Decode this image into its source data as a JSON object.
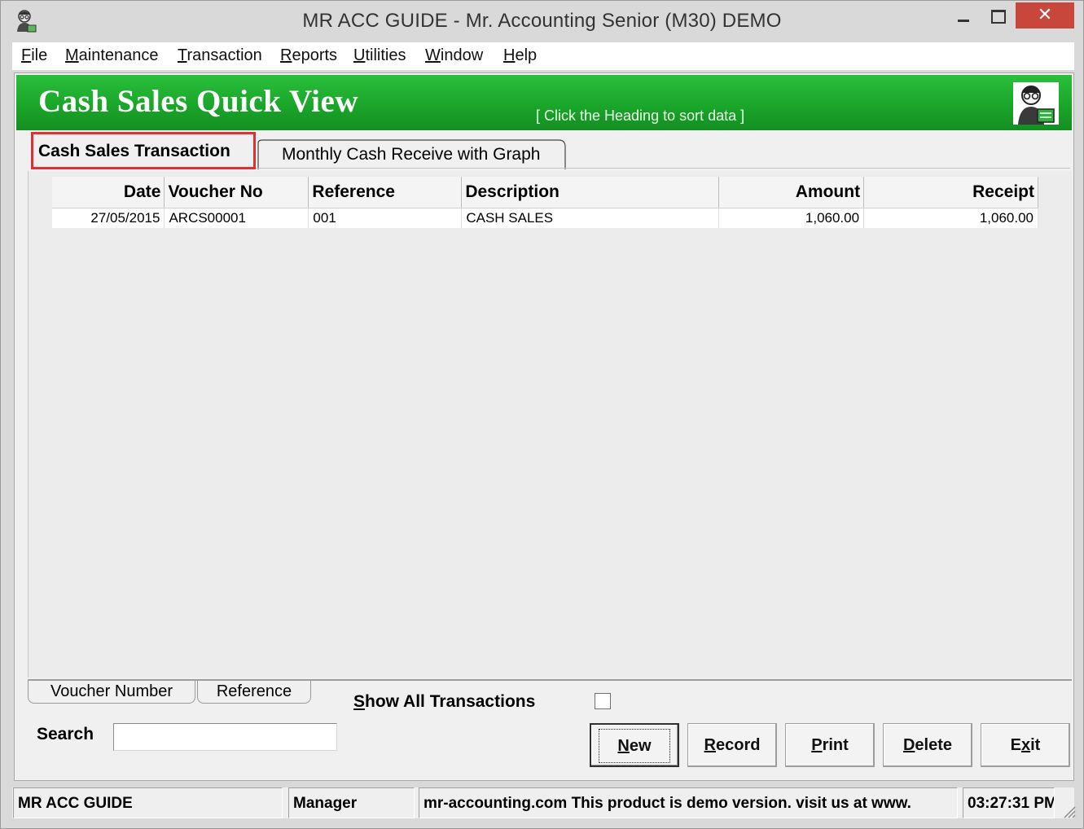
{
  "window": {
    "title": "MR ACC GUIDE - Mr. Accounting Senior (M30) DEMO",
    "close_glyph": "✕"
  },
  "menu": [
    {
      "label": "File",
      "hotkey": "F",
      "rest": "ile"
    },
    {
      "label": "Maintenance",
      "hotkey": "M",
      "rest": "aintenance"
    },
    {
      "label": "Transaction",
      "hotkey": "T",
      "rest": "ransaction"
    },
    {
      "label": "Reports",
      "hotkey": "R",
      "rest": "eports"
    },
    {
      "label": "Utilities",
      "hotkey": "U",
      "rest": "tilities"
    },
    {
      "label": "Window",
      "hotkey": "W",
      "rest": "indow"
    },
    {
      "label": "Help",
      "hotkey": "H",
      "rest": "elp"
    }
  ],
  "banner": {
    "title": "Cash Sales Quick View",
    "hint": "[ Click the Heading to sort data ]",
    "icon": "accountant-icon",
    "color": "#1aa62a"
  },
  "tabs": {
    "active": "Cash Sales Transaction",
    "inactive": "Monthly Cash  Receive with Graph",
    "highlight_color": "#e03030"
  },
  "table": {
    "columns": [
      "Date",
      "Voucher No",
      "Reference",
      "Description",
      "Amount",
      "Receipt"
    ],
    "rows": [
      [
        "27/05/2015",
        "ARCS00001",
        "001",
        "CASH SALES",
        "1,060.00",
        "1,060.00"
      ]
    ]
  },
  "search_tabs": [
    "Voucher Number",
    "Reference"
  ],
  "show_all": {
    "label_hotkey": "S",
    "label_rest": "how All Transactions",
    "checked": false
  },
  "search": {
    "label": "Search",
    "value": ""
  },
  "buttons": {
    "new": {
      "hotkey": "N",
      "rest": "ew"
    },
    "record": {
      "hotkey": "R",
      "rest": "ecord"
    },
    "print": {
      "hotkey": "P",
      "rest": "rint"
    },
    "delete": {
      "hotkey": "D",
      "rest": "elete"
    },
    "exit": {
      "pre": "E",
      "hotkey": "x",
      "rest": "it"
    }
  },
  "statusbar": {
    "app": "MR ACC GUIDE",
    "user": "Manager",
    "message": "mr-accounting.com This product is demo version.  visit us at www.",
    "time": "03:27:31 PM"
  }
}
